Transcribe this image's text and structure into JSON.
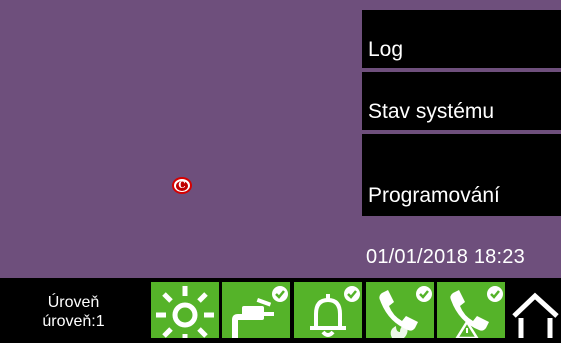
{
  "menu": {
    "log": "Log",
    "system_status": "Stav systému",
    "programming": "Programování"
  },
  "status": {
    "datetime": "01/01/2018 18:23"
  },
  "level": {
    "line1": "Úroveň",
    "line2": "úroveň:1"
  },
  "tiles": [
    {
      "name": "sun-icon"
    },
    {
      "name": "plug-icon",
      "badge": "check"
    },
    {
      "name": "bell-icon",
      "badge": "check"
    },
    {
      "name": "phone-fire-icon",
      "badge": "check"
    },
    {
      "name": "phone-warning-icon",
      "badge": "check"
    }
  ],
  "colors": {
    "background": "#6e4f7c",
    "tile_green": "#55b329",
    "button_black": "#000000"
  }
}
